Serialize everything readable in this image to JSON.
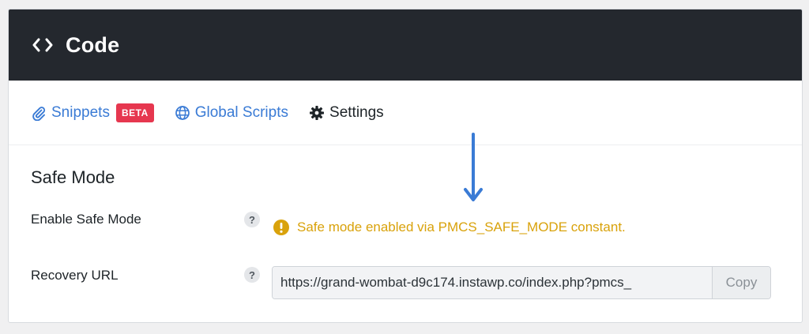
{
  "header": {
    "title": "Code",
    "icon": "code-icon"
  },
  "tabs": [
    {
      "label": "Snippets",
      "icon": "paperclip-icon",
      "badge": "BETA",
      "color": "#3a7bd5"
    },
    {
      "label": "Global Scripts",
      "icon": "globe-icon",
      "color": "#3a7bd5"
    },
    {
      "label": "Settings",
      "icon": "gear-icon",
      "active": true,
      "color": "#1d2327"
    }
  ],
  "section": {
    "title": "Safe Mode",
    "rows": [
      {
        "label": "Enable Safe Mode",
        "help": "?",
        "notice": "Safe mode enabled via PMCS_SAFE_MODE constant.",
        "notice_icon": "warning-icon",
        "notice_color": "#d9a20b"
      },
      {
        "label": "Recovery URL",
        "help": "?",
        "url_value": "https://grand-wombat-d9c174.instawp.co/index.php?pmcs_",
        "copy_label": "Copy"
      }
    ]
  },
  "annotation": {
    "icon": "down-arrow-icon",
    "color": "#3a7bd5"
  },
  "colors": {
    "header_bg": "#24282e",
    "badge_bg": "#e6374f",
    "page_bg": "#f0f0f1"
  }
}
